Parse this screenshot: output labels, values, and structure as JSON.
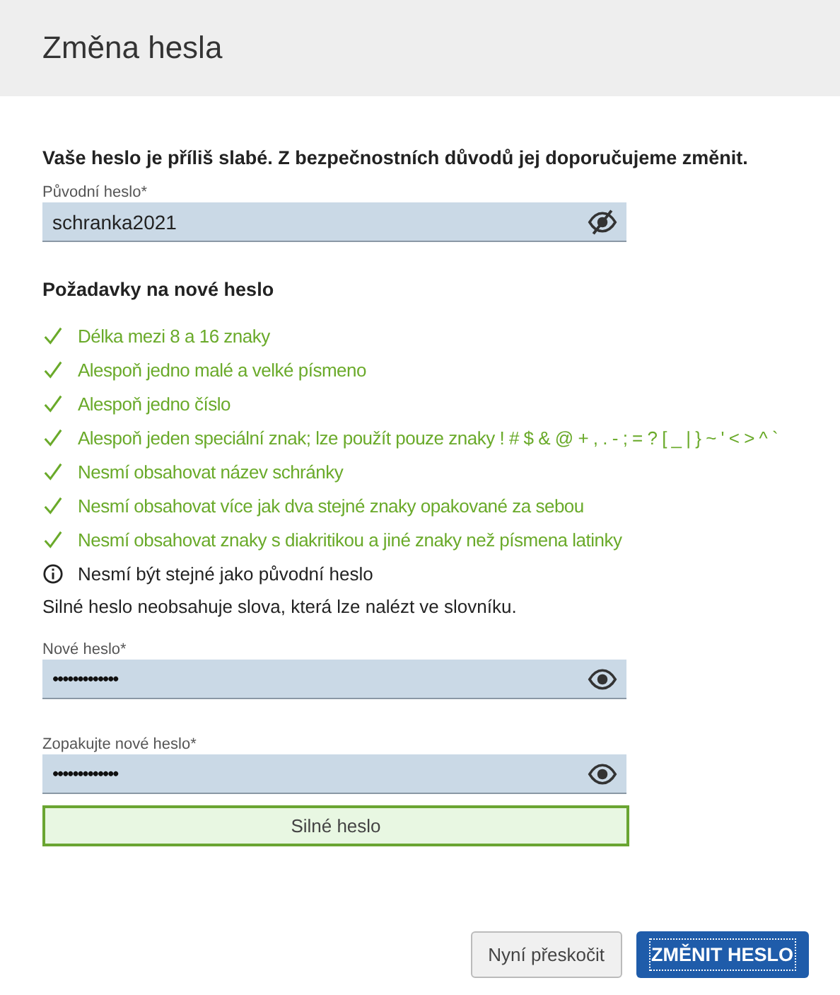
{
  "window": {
    "title": "Změna hesla"
  },
  "intro": "Vaše heslo je příliš slabé. Z bezpečnostních důvodů jej doporučujeme změnit.",
  "current_password": {
    "label": "Původní heslo*",
    "value": "schranka2021",
    "revealed": true
  },
  "requirements_title": "Požadavky na nové heslo",
  "requirements": [
    {
      "kind": "ok",
      "text": "Délka mezi 8 a 16 znaky"
    },
    {
      "kind": "ok",
      "text": "Alespoň jedno malé a velké písmeno"
    },
    {
      "kind": "ok",
      "text": "Alespoň jedno číslo"
    },
    {
      "kind": "ok",
      "text": "Alespoň jeden speciální znak; lze použít pouze znaky ! # $ & @ + , . - ; = ? [ _ | } ~ ' < > ^ `"
    },
    {
      "kind": "ok",
      "text": "Nesmí obsahovat název schránky"
    },
    {
      "kind": "ok",
      "text": "Nesmí obsahovat více jak dva stejné znaky opakované za sebou"
    },
    {
      "kind": "ok",
      "text": "Nesmí obsahovat znaky s diakritikou a jiné znaky než písmena latinky"
    },
    {
      "kind": "info",
      "text": "Nesmí být stejné jako původní heslo"
    }
  ],
  "note": "Silné heslo neobsahuje slova, která lze nalézt ve slovníku.",
  "new_password": {
    "label": "Nové heslo*",
    "value": "•••••••••••••",
    "revealed": false
  },
  "repeat_password": {
    "label": "Zopakujte nové heslo*",
    "value": "•••••••••••••",
    "revealed": false
  },
  "strength": {
    "label": "Silné heslo"
  },
  "buttons": [
    {
      "kind": "secondary",
      "label": "Nyní přeskočit"
    },
    {
      "kind": "primary",
      "label": "ZMĚNIT HESLO"
    }
  ]
}
